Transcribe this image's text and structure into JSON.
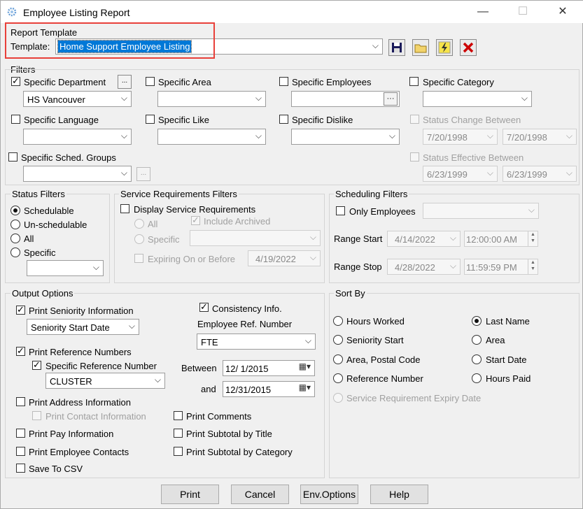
{
  "window": {
    "title": "Employee Listing Report",
    "min": "—",
    "max": "☐",
    "close": "✕"
  },
  "template": {
    "group": "Report Template",
    "label": "Template:",
    "value": "Home Support Employee Listing"
  },
  "filters": {
    "group": "Filters",
    "specific_department": {
      "label": "Specific Department",
      "checked": true,
      "value": "HS Vancouver",
      "more": "..."
    },
    "specific_area": {
      "label": "Specific Area"
    },
    "specific_employees": {
      "label": "Specific Employees",
      "more": "···"
    },
    "specific_category": {
      "label": "Specific Category"
    },
    "specific_language": {
      "label": "Specific Language"
    },
    "specific_like": {
      "label": "Specific Like"
    },
    "specific_dislike": {
      "label": "Specific Dislike"
    },
    "status_change": {
      "label": "Status Change Between",
      "from": "7/20/1998",
      "to": "7/20/1998"
    },
    "sched_groups": {
      "label": "Specific Sched. Groups",
      "more": "..."
    },
    "status_effective": {
      "label": "Status Effective Between",
      "from": "6/23/1999",
      "to": "6/23/1999"
    }
  },
  "status_filters": {
    "group": "Status Filters",
    "options": [
      "Schedulable",
      "Un-schedulable",
      "All",
      "Specific"
    ],
    "selected": "Schedulable"
  },
  "service_req": {
    "group": "Service Requirements Filters",
    "display": "Display Service Requirements",
    "all": "All",
    "include_archived": "Include Archived",
    "specific": "Specific",
    "expiring": "Expiring On or Before",
    "expiring_date": "4/19/2022"
  },
  "scheduling": {
    "group": "Scheduling Filters",
    "only_employees": "Only Employees",
    "range_start": "Range Start",
    "start_date": "4/14/2022",
    "start_time": "12:00:00 AM",
    "range_stop": "Range Stop",
    "stop_date": "4/28/2022",
    "stop_time": "11:59:59 PM"
  },
  "output": {
    "group": "Output Options",
    "print_seniority": "Print Seniority Information",
    "seniority_value": "Seniority Start Date",
    "consistency": "Consistency Info.",
    "emp_ref_label": "Employee Ref. Number",
    "emp_ref_value": "FTE",
    "print_ref": "Print Reference Numbers",
    "specific_ref": "Specific Reference Number",
    "ref_value": "CLUSTER",
    "between": "Between",
    "and": "and",
    "date_from": "12/ 1/2015",
    "date_to": "12/31/2015",
    "print_address": "Print Address Information",
    "print_contact": "Print Contact Information",
    "print_comments": "Print Comments",
    "print_pay": "Print Pay Information",
    "subtotal_title": "Print Subtotal by Title",
    "print_emp_contacts": "Print Employee Contacts",
    "subtotal_category": "Print Subtotal by Category",
    "save_csv": "Save To CSV"
  },
  "sort": {
    "group": "Sort By",
    "hours_worked": "Hours Worked",
    "last_name": "Last Name",
    "seniority_start": "Seniority Start",
    "area": "Area",
    "area_postal": "Area, Postal Code",
    "start_date": "Start Date",
    "ref_number": "Reference Number",
    "hours_paid": "Hours Paid",
    "service_expiry": "Service Requirement Expiry Date",
    "selected": "Last Name"
  },
  "buttons": {
    "print": "Print",
    "cancel": "Cancel",
    "env": "Env.Options",
    "help": "Help"
  },
  "colors": {
    "highlight": "#0078d7",
    "annotation": "#e8403a"
  }
}
